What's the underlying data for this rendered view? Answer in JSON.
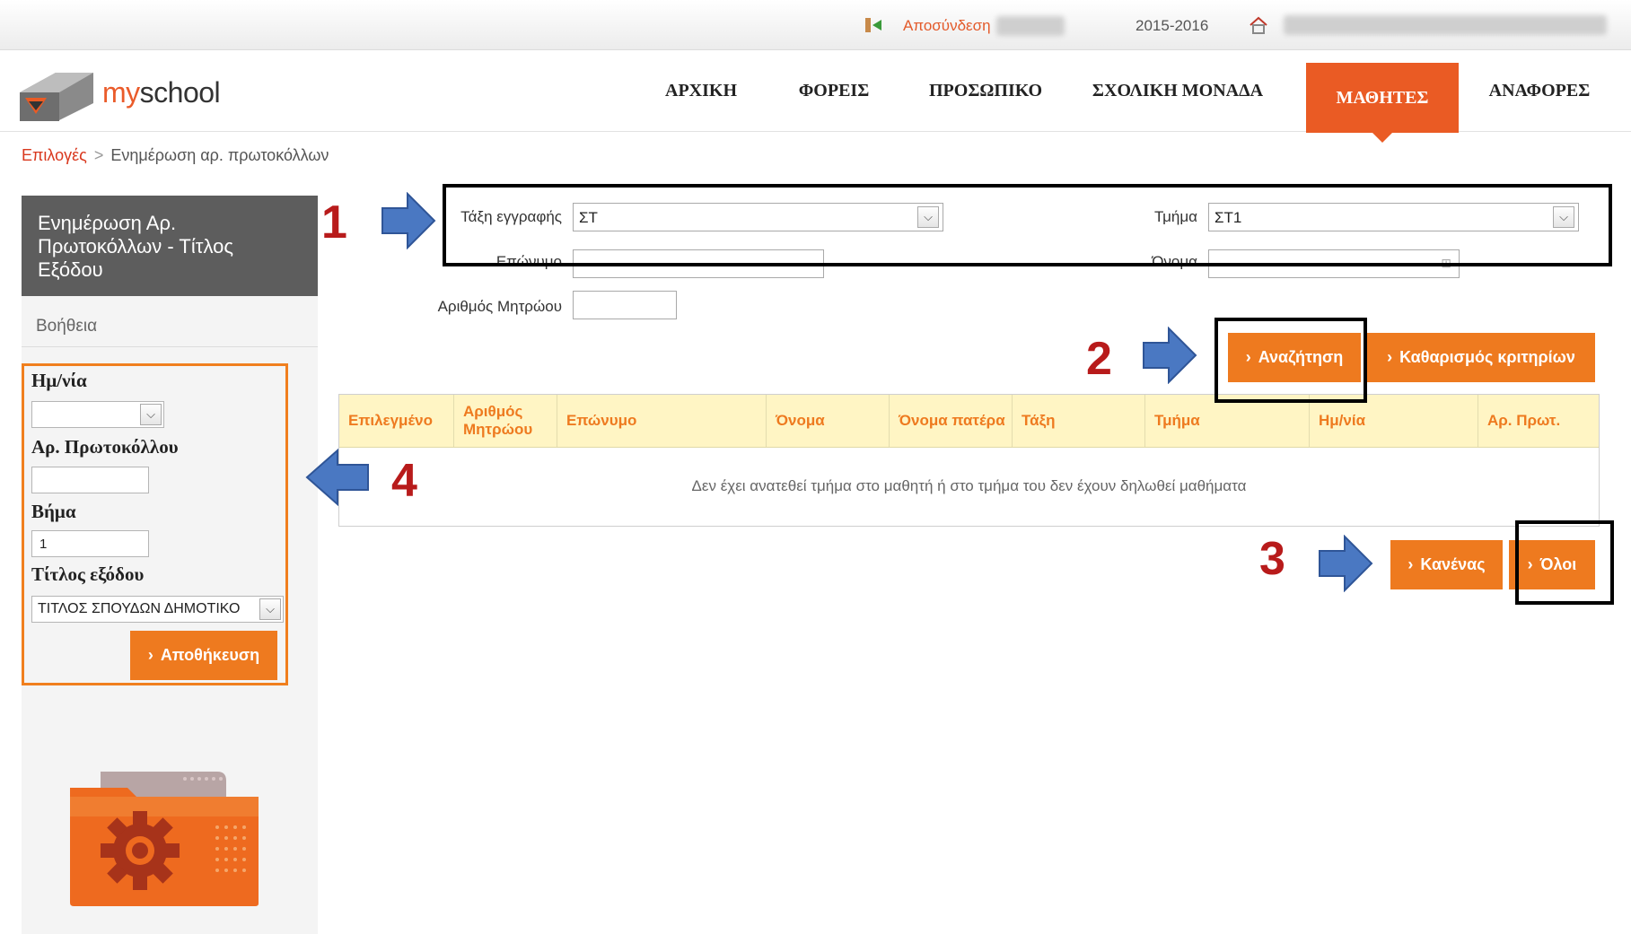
{
  "topbar": {
    "logout_label": "Αποσύνδεση",
    "year": "2015-2016"
  },
  "brand": {
    "logo_my": "my",
    "logo_school": "school"
  },
  "nav": {
    "items": [
      {
        "label": "ΑΡΧΙΚΗ"
      },
      {
        "label": "ΦΟΡΕΙΣ"
      },
      {
        "label": "ΠΡΟΣΩΠΙΚΟ"
      },
      {
        "label": "ΣΧΟΛΙΚΗ ΜΟΝΑΔΑ"
      },
      {
        "label": "ΜΑΘΗΤΕΣ",
        "active": true
      },
      {
        "label": "ΑΝΑΦΟΡΕΣ"
      }
    ],
    "accent": "#ea5b24"
  },
  "breadcrumb": {
    "root": "Επιλογές",
    "separator": ">",
    "current": "Ενημέρωση αρ. πρωτοκόλλων"
  },
  "sidebar": {
    "title": "Ενημέρωση Αρ. Πρωτοκόλλων - Τίτλος Εξόδου",
    "help": "Βοήθεια",
    "date_label": "Ημ/νία",
    "date_value": "",
    "protocol_label": "Αρ. Πρωτοκόλλου",
    "protocol_value": "",
    "step_label": "Βήμα",
    "step_value": "1",
    "exit_title_label": "Τίτλος εξόδου",
    "exit_title_value": "ΤΙΤΛΟΣ ΣΠΟΥΔΩΝ ΔΗΜΟΤΙΚΟ",
    "save_label": "Αποθήκευση"
  },
  "filters": {
    "class_label": "Τάξη εγγραφής",
    "class_value": "ΣΤ",
    "section_label": "Τμήμα",
    "section_value": "ΣΤ1",
    "surname_label": "Επώνυμο",
    "name_label": "Όνομα",
    "registry_label": "Αριθμός Μητρώου",
    "search_label": "Αναζήτηση",
    "clear_label": "Καθαρισμός κριτηρίων"
  },
  "table": {
    "columns": [
      "Επιλεγμένο",
      "Αριθμός Μητρώου",
      "Επώνυμο",
      "Όνομα",
      "Όνομα πατέρα",
      "Τάξη",
      "Τμήμα",
      "Ημ/νία",
      "Αρ. Πρωτ."
    ],
    "empty_message": "Δεν έχει ανατεθεί τμήμα στο μαθητή ή στο τμήμα του δεν έχουν δηλωθεί μαθήματα"
  },
  "selection": {
    "none_label": "Κανένας",
    "all_label": "Όλοι"
  },
  "annotations": [
    "1",
    "2",
    "3",
    "4"
  ],
  "colors": {
    "button": "#ee7a1f",
    "table_header_bg": "#fff5c4",
    "annotation_number": "#b81b1b",
    "arrow": "#4a78c2"
  }
}
